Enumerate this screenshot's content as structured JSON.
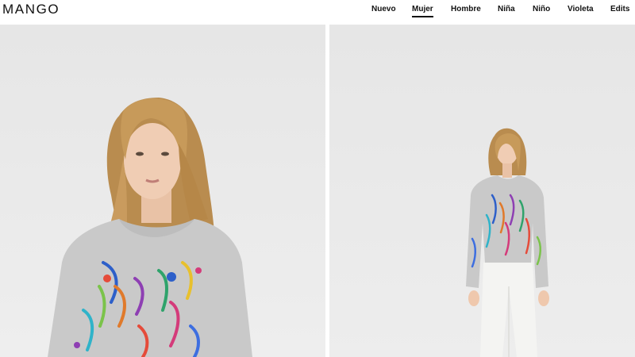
{
  "header": {
    "logo": "MANGO",
    "nav": [
      {
        "label": "Nuevo",
        "active": false
      },
      {
        "label": "Mujer",
        "active": true
      },
      {
        "label": "Hombre",
        "active": false
      },
      {
        "label": "Niña",
        "active": false
      },
      {
        "label": "Niño",
        "active": false
      },
      {
        "label": "Violeta",
        "active": false
      },
      {
        "label": "Edits",
        "active": false
      }
    ]
  },
  "gallery": {
    "images": [
      {
        "name": "product-photo-closeup"
      },
      {
        "name": "product-photo-full"
      }
    ]
  },
  "colors": {
    "background": "#ffffff",
    "photo_background": "#ececec",
    "sweater": "#c9c9c9",
    "hair": "#c79a5a",
    "jeans": "#f4f4f2"
  }
}
